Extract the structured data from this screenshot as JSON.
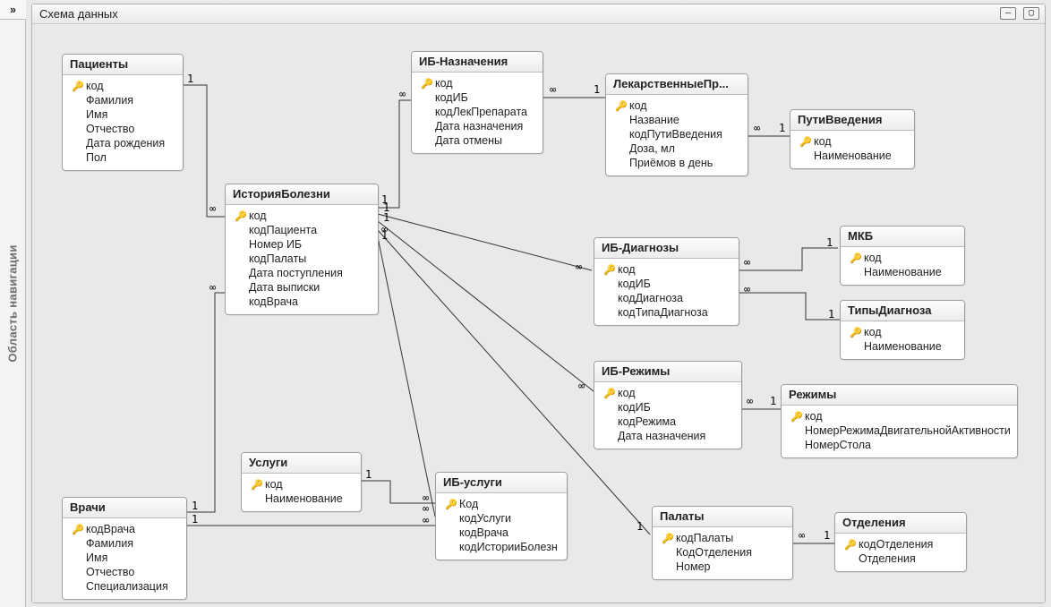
{
  "nav": {
    "toggle": "»",
    "label": "Область навигации"
  },
  "window": {
    "title": "Схема данных",
    "min": "—",
    "max": "▢"
  },
  "rel_labels": {
    "one": "1",
    "many": "∞"
  },
  "tables": {
    "patients": {
      "title": "Пациенты",
      "fields": [
        "код",
        "Фамилия",
        "Имя",
        "Отчество",
        "Дата рождения",
        "Пол"
      ],
      "keyIndex": 0
    },
    "history": {
      "title": "ИсторияБолезни",
      "fields": [
        "код",
        "кодПациента",
        "Номер ИБ",
        "кодПалаты",
        "Дата поступления",
        "Дата выписки",
        "кодВрача"
      ],
      "keyIndex": 0
    },
    "doctors": {
      "title": "Врачи",
      "fields": [
        "кодВрача",
        "Фамилия",
        "Имя",
        "Отчество",
        "Специализация"
      ],
      "keyIndex": 0
    },
    "services": {
      "title": "Услуги",
      "fields": [
        "код",
        "Наименование"
      ],
      "keyIndex": 0
    },
    "ib_services": {
      "title": "ИБ-услуги",
      "fields": [
        "Код",
        "кодУслуги",
        "кодВрача",
        "кодИсторииБолезн"
      ],
      "keyIndex": 0
    },
    "ib_assign": {
      "title": "ИБ-Назначения",
      "fields": [
        "код",
        "кодИБ",
        "кодЛекПрепарата",
        "Дата назначения",
        "Дата отмены"
      ],
      "keyIndex": 0
    },
    "drugs": {
      "title": "ЛекарственныеПр...",
      "fields": [
        "код",
        "Название",
        "кодПутиВведения",
        "Доза, мл",
        "Приёмов в день"
      ],
      "keyIndex": 0
    },
    "routes": {
      "title": "ПутиВведения",
      "fields": [
        "код",
        "Наименование"
      ],
      "keyIndex": 0
    },
    "ib_diag": {
      "title": "ИБ-Диагнозы",
      "fields": [
        "код",
        "кодИБ",
        "кодДиагноза",
        "кодТипаДиагноза"
      ],
      "keyIndex": 0
    },
    "mkb": {
      "title": "МКБ",
      "fields": [
        "код",
        "Наименование"
      ],
      "keyIndex": 0
    },
    "diag_types": {
      "title": "ТипыДиагноза",
      "fields": [
        "код",
        "Наименование"
      ],
      "keyIndex": 0
    },
    "ib_modes": {
      "title": "ИБ-Режимы",
      "fields": [
        "код",
        "кодИБ",
        "кодРежима",
        "Дата назначения"
      ],
      "keyIndex": 0
    },
    "modes": {
      "title": "Режимы",
      "fields": [
        "код",
        "НомерРежимаДвигательнойАктивности",
        "НомерСтола"
      ],
      "keyIndex": 0
    },
    "wards": {
      "title": "Палаты",
      "fields": [
        "кодПалаты",
        "КодОтделения",
        "Номер"
      ],
      "keyIndex": 0
    },
    "departments": {
      "title": "Отделения",
      "fields": [
        "кодОтделения",
        "Отделения"
      ],
      "keyIndex": 0
    }
  }
}
